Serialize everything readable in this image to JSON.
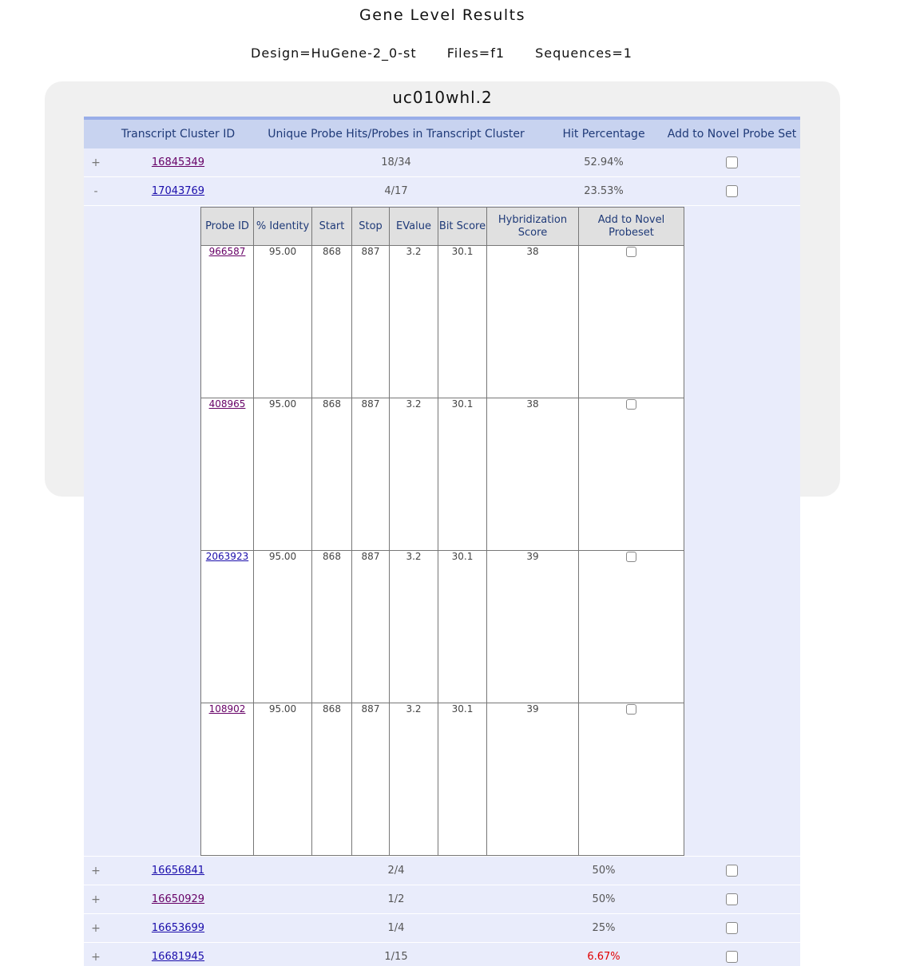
{
  "page": {
    "title": "Gene Level Results",
    "design": "Design=HuGene-2_0-st",
    "files": "Files=f1",
    "sequences": "Sequences=1"
  },
  "panel": {
    "title": "uc010whl.2"
  },
  "results_table": {
    "headers": [
      "Transcript Cluster ID",
      "Unique Probe Hits/Probes in Transcript Cluster",
      "Hit Percentage",
      "Add to Novel Probe Set"
    ],
    "rows": [
      {
        "expander": "+",
        "id": "16845349",
        "hits": "18/34",
        "percent": "52.94%"
      },
      {
        "expander": "-",
        "id": "17043769",
        "hits": "4/17",
        "percent": "23.53%"
      },
      {
        "expander": "+",
        "id": "16656841",
        "hits": "2/4",
        "percent": "50%"
      },
      {
        "expander": "+",
        "id": "16650929",
        "hits": "1/2",
        "percent": "50%"
      },
      {
        "expander": "+",
        "id": "16653699",
        "hits": "1/4",
        "percent": "25%"
      },
      {
        "expander": "+",
        "id": "16681945",
        "hits": "1/15",
        "percent": "6.67%"
      }
    ]
  },
  "probe_table": {
    "headers": {
      "probe_id": "Probe ID",
      "identity": "% Identity",
      "start": "Start",
      "stop": "Stop",
      "evalue": "EValue",
      "bit_score": "Bit Score",
      "hybridization": "Hybridization Score",
      "add_novel": "Add to Novel Probeset"
    },
    "rows": [
      {
        "probe_id": "966587",
        "identity": "95.00",
        "start": "868",
        "stop": "887",
        "evalue": "3.2",
        "bit_score": "30.1",
        "hybridization": "38"
      },
      {
        "probe_id": "408965",
        "identity": "95.00",
        "start": "868",
        "stop": "887",
        "evalue": "3.2",
        "bit_score": "30.1",
        "hybridization": "38"
      },
      {
        "probe_id": "2063923",
        "identity": "95.00",
        "start": "868",
        "stop": "887",
        "evalue": "3.2",
        "bit_score": "30.1",
        "hybridization": "39"
      },
      {
        "probe_id": "108902",
        "identity": "95.00",
        "start": "868",
        "stop": "887",
        "evalue": "3.2",
        "bit_score": "30.1",
        "hybridization": "39"
      }
    ]
  },
  "colors": {
    "header_bg": "#c8d3f0",
    "row_bg": "#e9ecfb",
    "low_percent": "#e00000",
    "visited_link": "#660066",
    "link": "#1a0dab"
  }
}
